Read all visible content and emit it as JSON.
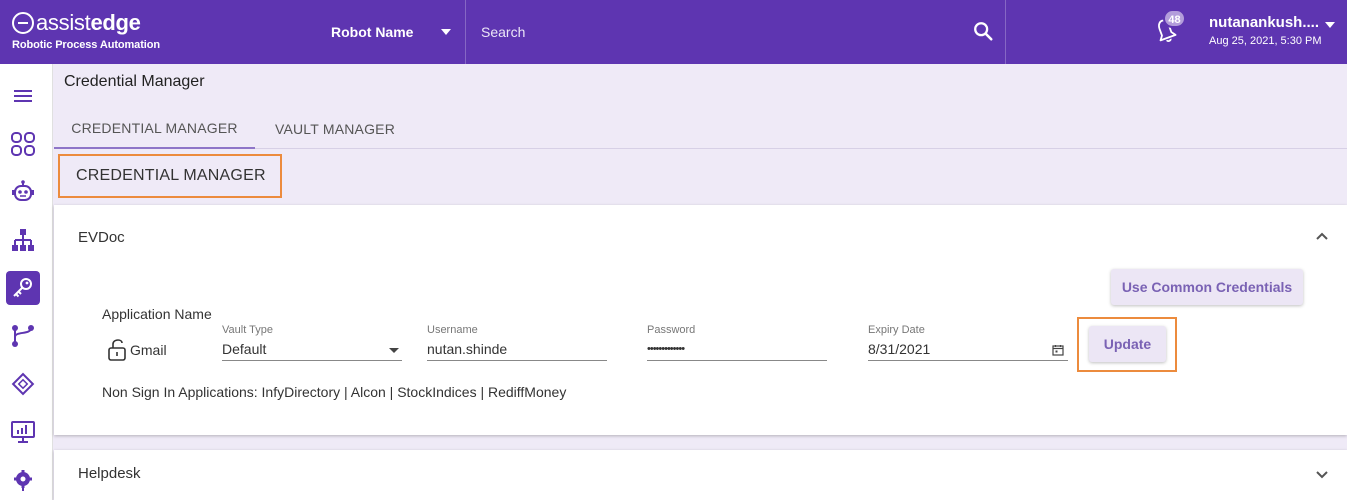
{
  "header": {
    "logo_text_light": "assist",
    "logo_text_bold": "edge",
    "logo_subtitle": "Robotic Process Automation",
    "robot_select_label": "Robot Name",
    "search_placeholder": "Search",
    "notification_count": "48",
    "user_name": "nutanankush....",
    "user_datetime": "Aug 25, 2021, 5:30 PM"
  },
  "rail": {
    "items": [
      {
        "icon": "menu-icon"
      },
      {
        "icon": "dashboard-icon"
      },
      {
        "icon": "robot-icon"
      },
      {
        "icon": "hierarchy-icon"
      },
      {
        "icon": "key-icon",
        "active": true
      },
      {
        "icon": "workflow-icon"
      },
      {
        "icon": "chip-icon"
      },
      {
        "icon": "monitor-chart-icon"
      },
      {
        "icon": "settings-gear-icon"
      }
    ]
  },
  "page": {
    "title": "Credential Manager",
    "tabs": [
      {
        "label": "CREDENTIAL MANAGER",
        "active": true
      },
      {
        "label": "VAULT MANAGER",
        "active": false
      }
    ],
    "section_title": "CREDENTIAL MANAGER"
  },
  "panel": {
    "title": "EVDoc",
    "common_button": "Use Common Credentials",
    "application_name_label": "Application Name",
    "application_name_value": "Gmail",
    "vault_type": {
      "label": "Vault Type",
      "value": "Default"
    },
    "username": {
      "label": "Username",
      "value": "nutan.shinde"
    },
    "password": {
      "label": "Password",
      "value": "•••••••••••••"
    },
    "expiry_date": {
      "label": "Expiry Date",
      "value": "8/31/2021"
    },
    "update_button": "Update",
    "non_sign_in": "Non Sign In Applications: InfyDirectory | Alcon | StockIndices | RediffMoney"
  },
  "panel2": {
    "title": "Helpdesk"
  },
  "colors": {
    "primary": "#5e35b1",
    "highlight_border": "#ec8b3d",
    "button_bg": "#ece6f5",
    "button_text": "#7a62b4"
  }
}
